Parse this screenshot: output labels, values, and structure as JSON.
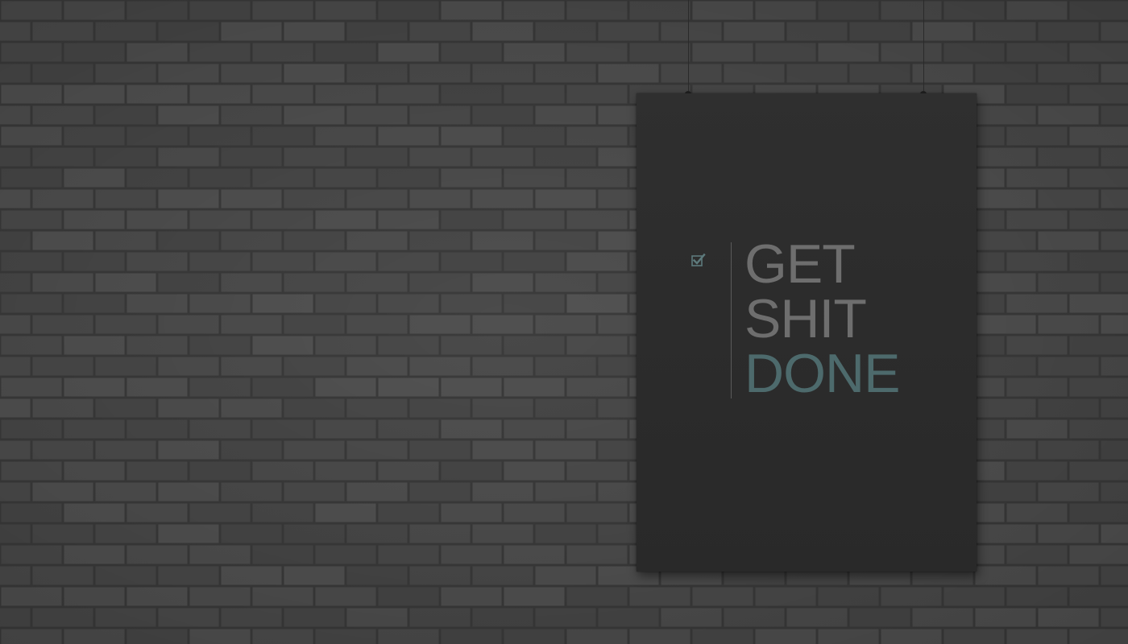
{
  "scene": {
    "description_colors": {
      "wall": "#4a4a4a",
      "poster": "#2d2d2d",
      "text_gray": "#6e6e6e",
      "text_accent": "#4d6a6c"
    }
  },
  "poster": {
    "icon": "checked-checkbox-icon",
    "lines": [
      "GET",
      "SHIT",
      "DONE"
    ]
  }
}
